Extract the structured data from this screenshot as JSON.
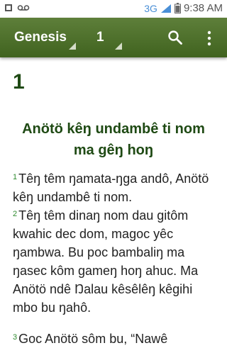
{
  "status_bar": {
    "network": "3G",
    "time": "9:38 AM"
  },
  "toolbar": {
    "book": "Genesis",
    "chapter": "1"
  },
  "content": {
    "chapter_number": "1",
    "heading": "Anötö kêŋ undambê ti nom ma gêŋ hoŋ",
    "verses": [
      {
        "num": "1",
        "text": "Têŋ têm ŋamata-ŋga andô, Anötö kêŋ undambê ti nom."
      },
      {
        "num": "2",
        "text": "Têŋ têm dinaŋ nom dau gitôm kwahic dec dom, magoc yêc ŋambwa. Bu poc bambaliŋ ma ŋasec kôm gameŋ hoŋ ahuc. Ma Anötö ndê Ŋalau kêsêlêŋ kêgihi mbo bu ŋahô."
      },
      {
        "num": "3",
        "text": "Goc Anötö sôm bu, “Nawê"
      }
    ]
  },
  "colors": {
    "toolbar": "#4f7130",
    "heading": "#1f4a14",
    "verse_number": "#2e8b2e"
  }
}
